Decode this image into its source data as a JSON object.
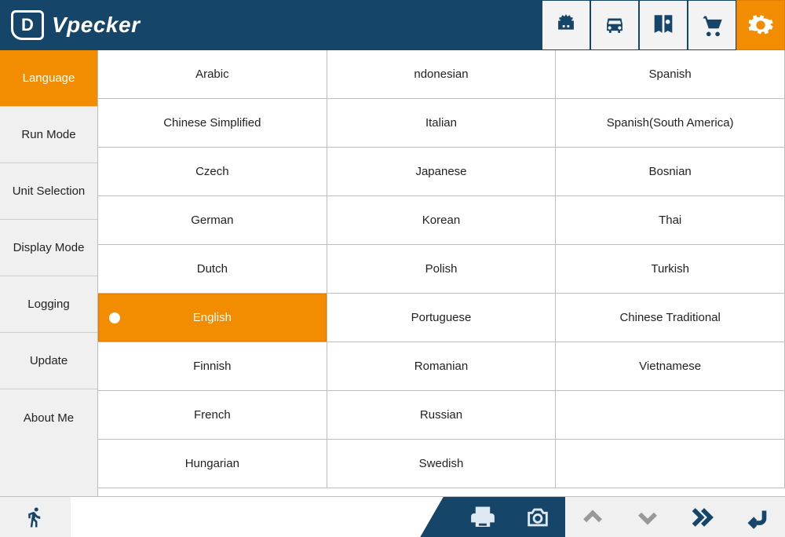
{
  "brand": {
    "logo_letter": "D",
    "name": "Vpecker"
  },
  "colors": {
    "accent": "#F28C00",
    "primary": "#15466A"
  },
  "sidebar": {
    "items": [
      {
        "label": "Language",
        "active": true
      },
      {
        "label": "Run Mode",
        "active": false
      },
      {
        "label": "Unit Selection",
        "active": false
      },
      {
        "label": "Display Mode",
        "active": false
      },
      {
        "label": "Logging",
        "active": false
      },
      {
        "label": "Update",
        "active": false
      },
      {
        "label": "About Me",
        "active": false
      }
    ]
  },
  "languages": {
    "selected": "English",
    "rows": [
      [
        "Arabic",
        "ndonesian",
        "Spanish"
      ],
      [
        "Chinese Simplified",
        "Italian",
        "Spanish(South America)"
      ],
      [
        "Czech",
        "Japanese",
        "Bosnian"
      ],
      [
        "German",
        "Korean",
        "Thai"
      ],
      [
        "Dutch",
        "Polish",
        "Turkish"
      ],
      [
        "English",
        "Portuguese",
        "Chinese Traditional"
      ],
      [
        "Finnish",
        "Romanian",
        "Vietnamese"
      ],
      [
        "French",
        "Russian",
        ""
      ],
      [
        "Hungarian",
        "Swedish",
        ""
      ]
    ]
  },
  "top_icons": [
    "diagnostics",
    "vehicle",
    "manual",
    "shop",
    "settings"
  ],
  "top_icon_active": "settings",
  "bottom": {
    "left_icon": "exit",
    "icons": [
      "print",
      "camera",
      "up",
      "down",
      "forward",
      "back"
    ]
  }
}
